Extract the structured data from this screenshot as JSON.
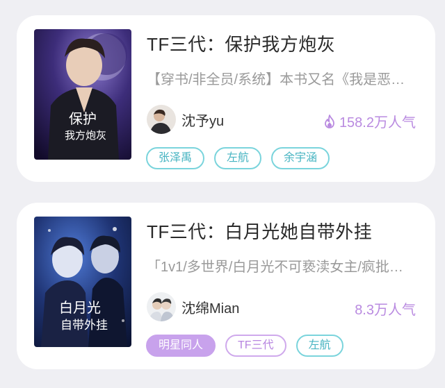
{
  "books": [
    {
      "title": "TF三代：保护我方炮灰",
      "description": "【穿书/非全员/系统】本书又名《我是恶…",
      "author": "沈予yu",
      "popularity": "158.2万人气",
      "show_flame": true,
      "cover_text_1": "保护",
      "cover_text_2": "我方炮灰",
      "tags": [
        "张泽禹",
        "左航",
        "余宇涵"
      ]
    },
    {
      "title": "TF三代：白月光她自带外挂",
      "description": "「1v1/多世界/白月光不可亵渎女主/疯批…",
      "author": "沈绵Mian",
      "popularity": "8.3万人气",
      "show_flame": false,
      "cover_text_1": "白月光",
      "cover_text_2": "自带外挂",
      "tags": [
        "明星同人",
        "TF三代",
        "左航"
      ]
    }
  ],
  "colors": {
    "background": "#efeff3",
    "card": "#ffffff",
    "tag_teal": "#47b4c2",
    "tag_purple": "#b785e0",
    "popularity": "#b98ae0"
  },
  "icons": {
    "popularity": "flame-icon"
  }
}
